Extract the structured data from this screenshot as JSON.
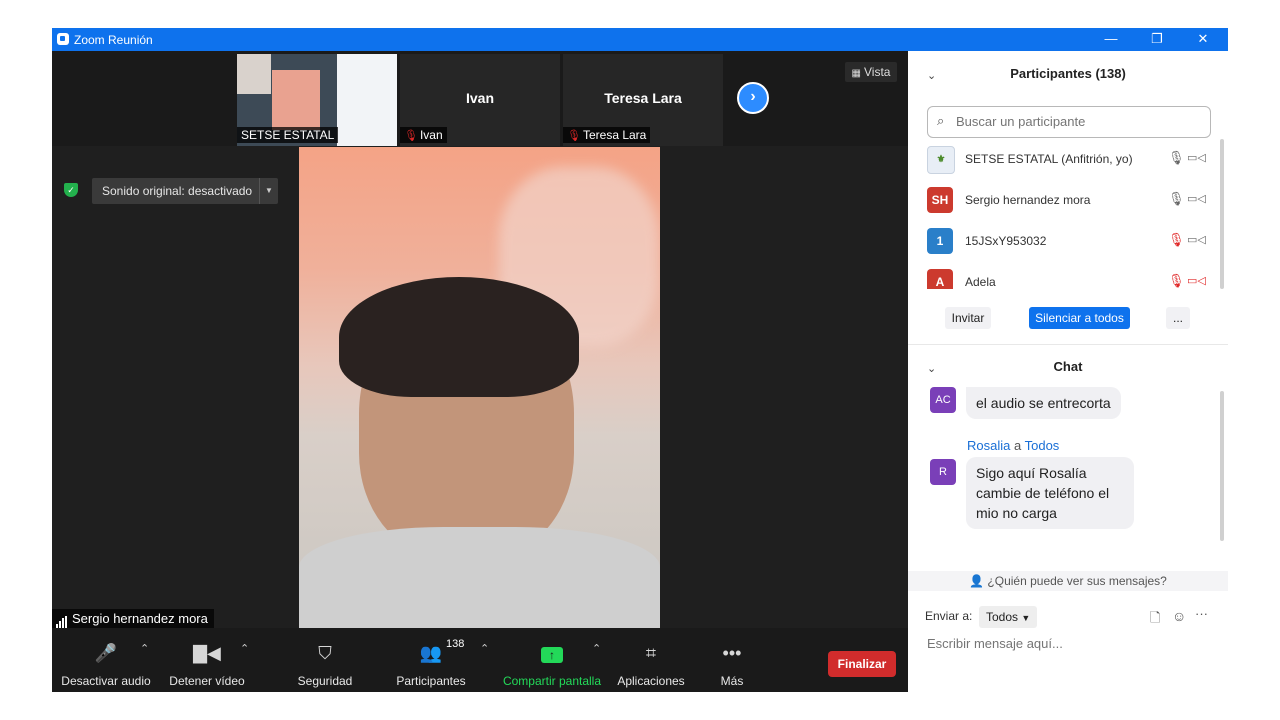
{
  "window": {
    "title": "Zoom Reunión",
    "minimize": "—",
    "restore": "❐",
    "close": "✕"
  },
  "thumbnails": [
    {
      "name": "SETSE ESTATAL"
    },
    {
      "big_name": "Ivan",
      "name": "Ivan"
    },
    {
      "big_name": "Teresa Lara",
      "name": "Teresa Lara"
    }
  ],
  "next_arrow": "›",
  "vista_label": "Vista",
  "sonido_label": "Sonido original: desactivado",
  "main_speaker": "Sergio hernandez mora",
  "toolbar": {
    "audio": "Desactivar audio",
    "video": "Detener vídeo",
    "security": "Seguridad",
    "participants": "Participantes",
    "participants_count": "138",
    "share": "Compartir pantalla",
    "apps": "Aplicaciones",
    "more": "Más",
    "end": "Finalizar"
  },
  "participants_panel": {
    "title": "Participantes (138)",
    "search_placeholder": "Buscar un participante",
    "list": [
      {
        "initials": "",
        "name": "SETSE ESTATAL (Anfitrión, yo)",
        "mic_muted": false,
        "cam_off": false,
        "color": "#e8eef6"
      },
      {
        "initials": "SH",
        "name": "Sergio hernandez mora",
        "mic_muted": false,
        "cam_off": false,
        "color": "#cc3a2e"
      },
      {
        "initials": "1",
        "name": "15JSxY953032",
        "mic_muted": true,
        "cam_off": false,
        "color": "#2a7fc9"
      },
      {
        "initials": "A",
        "name": "Adela",
        "mic_muted": true,
        "cam_off": true,
        "color": "#cc3a2e"
      }
    ],
    "invite": "Invitar",
    "mute_all": "Silenciar a todos",
    "more": "..."
  },
  "chat": {
    "title": "Chat",
    "messages": [
      {
        "avatar": "AC",
        "text": "el audio se entrecorta"
      },
      {
        "avatar": "R",
        "sender": "Rosalia",
        "to_word": "a",
        "recipient": "Todos",
        "text": "Sigo aquí Rosalía cambie de teléfono el mio no carga"
      }
    ],
    "who_can_see": "¿Quién puede ver sus mensajes?",
    "send_to_label": "Enviar a:",
    "send_to_value": "Todos",
    "input_placeholder": "Escribir mensaje aquí..."
  },
  "colors": {
    "accent": "#0e72ed",
    "share_green": "#23d959",
    "end_red": "#d12c2c",
    "mute_all_blue": "#0e72ed"
  }
}
